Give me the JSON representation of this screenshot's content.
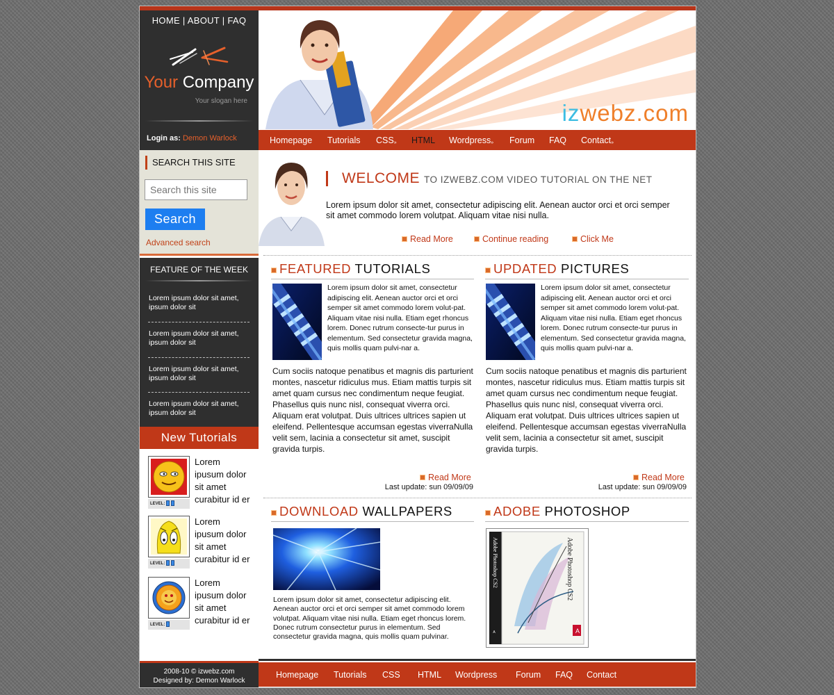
{
  "top_nav": {
    "home": "HOME",
    "about": "ABOUT",
    "faq": "FAQ",
    "sep": "|"
  },
  "brand": {
    "company_word1": "Your",
    "company_word2": "Company",
    "slogan": "Your slogan here"
  },
  "login": {
    "label": "Login as:",
    "user": "Demon Warlock"
  },
  "search": {
    "title": "SEARCH THIS SITE",
    "placeholder": "Search this site",
    "button": "Search",
    "advanced": "Advanced search"
  },
  "feature": {
    "title": "FEATURE OF THE WEEK",
    "items": [
      "Lorem ipsum dolor sit amet, ipsum dolor sit",
      "Lorem ipsum dolor sit amet, ipsum dolor sit",
      "Lorem ipsum dolor sit amet, ipsum dolor sit",
      "Lorem ipsum dolor sit amet, ipsum dolor sit"
    ]
  },
  "new_tutorials": {
    "title": "New Tutorials",
    "level_label": "LEVEL:",
    "items": [
      {
        "text": "Lorem ipusum dolor sit amet curabitur id er",
        "level": 2
      },
      {
        "text": "Lorem ipusum dolor sit amet curabitur id er",
        "level": 2
      },
      {
        "text": "Lorem ipusum dolor sit amet curabitur id er",
        "level": 1
      }
    ]
  },
  "footer_left": {
    "line1": "2008-10 © izwebz.com",
    "line2": "Designed by: Demon Warlock"
  },
  "header": {
    "site_prefix": "iz",
    "site_rest": "webz.com"
  },
  "main_nav": {
    "homepage": "Homepage",
    "tutorials": "Tutorials",
    "css": "CSS",
    "html": "HTML",
    "wordpress": "Wordpress",
    "forum": "Forum",
    "faq": "FAQ",
    "contact": "Contact",
    "arrow": "»"
  },
  "welcome": {
    "title": "WELCOME",
    "subtitle": "TO IZWEBZ.COM VIDEO TUTORIAL ON THE NET",
    "text": "Lorem ipsum dolor sit amet, consectetur adipiscing elit. Aenean auctor orci et orci semper sit amet commodo lorem volutpat. Aliquam vitae nisi nulla.",
    "links": [
      "Read More",
      "Continue reading",
      "Click Me"
    ]
  },
  "featured": {
    "title_hl": "FEATURED",
    "title_rest": "TUTORIALS",
    "blurb": "Lorem ipsum dolor sit amet, consectetur adipiscing elit. Aenean auctor orci et orci semper sit amet commodo lorem volut-pat. Aliquam vitae nisi nulla. Etiam eget rhoncus lorem. Donec rutrum consecte-tur purus in elementum. Sed consectetur gravida magna, quis mollis quam pulvi-nar a.",
    "para": "Cum sociis natoque penatibus et magnis dis parturient montes, nascetur ridiculus mus. Etiam mattis turpis sit amet quam cursus nec condimentum neque feugiat. Phasellus quis nunc nisl, consequat viverra orci. Aliquam erat volutpat. Duis ultrices ultrices sapien ut eleifend. Pellentesque accumsan egestas viverraNulla velit sem, lacinia a consectetur sit amet, suscipit gravida turpis.",
    "read_more": "Read More",
    "last_update": "Last update: sun 09/09/09"
  },
  "updated": {
    "title_hl": "UPDATED",
    "title_rest": "PICTURES",
    "blurb": "Lorem ipsum dolor sit amet, consectetur adipiscing elit. Aenean auctor orci et orci semper sit amet commodo lorem volut-pat. Aliquam vitae nisi nulla. Etiam eget rhoncus lorem. Donec rutrum consecte-tur purus in elementum. Sed consectetur gravida magna, quis mollis quam pulvi-nar a.",
    "para": "Cum sociis natoque penatibus et magnis dis parturient montes, nascetur ridiculus mus. Etiam mattis turpis sit amet quam cursus nec condimentum neque feugiat. Phasellus quis nunc nisl, consequat viverra orci. Aliquam erat volutpat. Duis ultrices ultrices sapien ut eleifend. Pellentesque accumsan egestas viverraNulla velit sem, lacinia a consectetur sit amet, suscipit gravida turpis.",
    "read_more": "Read More",
    "last_update": "Last update: sun 09/09/09"
  },
  "download": {
    "title_hl": "DOWNLOAD",
    "title_rest": "WALLPAPERS",
    "text": "Lorem ipsum dolor sit amet, consectetur adipiscing elit. Aenean auctor orci et orci semper sit amet commodo lorem volutpat. Aliquam vitae nisi nulla. Etiam eget rhoncus lorem. Donec rutrum consectetur purus in elementum. Sed consectetur gravida magna, quis mollis quam pulvinar."
  },
  "adobe": {
    "title_hl": "ADOBE",
    "title_rest": "PHOTOSHOP",
    "box_text": "Adobe Photoshop CS2"
  },
  "footer_nav": {
    "homepage": "Homepage",
    "tutorials": "Tutorials",
    "css": "CSS",
    "html": "HTML",
    "wordpress": "Wordpress",
    "forum": "Forum",
    "faq": "FAQ",
    "contact": "Contact"
  },
  "colors": {
    "accent": "#c03818",
    "dark": "#2f2f2f",
    "search_button": "#1d7ef0",
    "site_name_orange": "#ef7f2a",
    "site_name_blue": "#3dbde2"
  }
}
